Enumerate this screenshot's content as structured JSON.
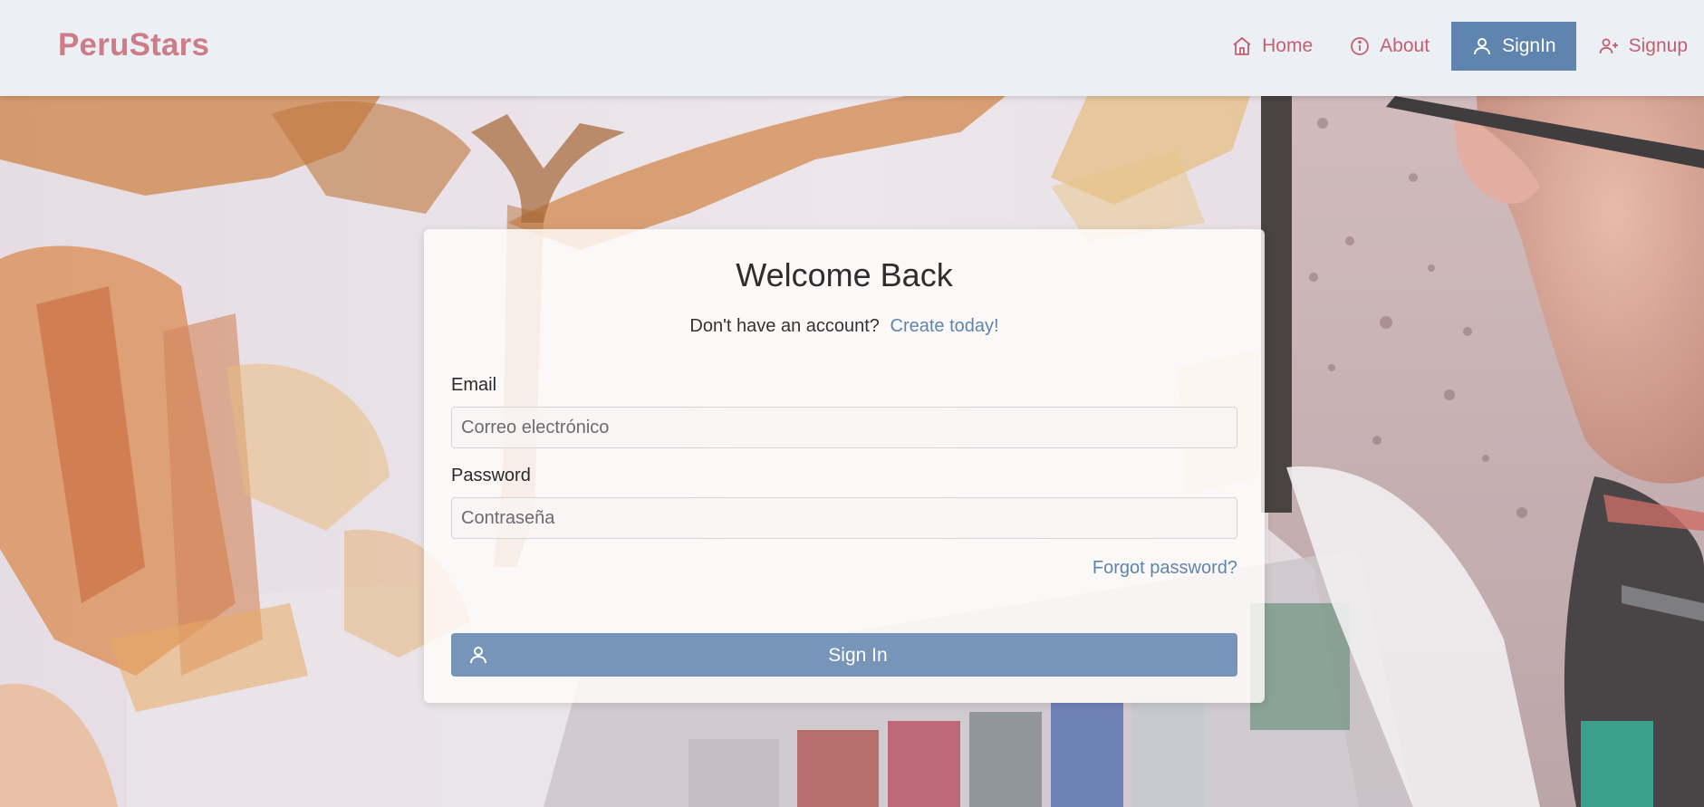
{
  "brand": {
    "name": "PeruStars"
  },
  "nav": {
    "items": [
      {
        "label": "Home",
        "icon": "home-icon",
        "active": false
      },
      {
        "label": "About",
        "icon": "info-icon",
        "active": false
      },
      {
        "label": "SignIn",
        "icon": "user-icon",
        "active": true
      },
      {
        "label": "Signup",
        "icon": "user-plus-icon",
        "active": false
      }
    ]
  },
  "login": {
    "title": "Welcome Back",
    "prompt": "Don't have an account?",
    "create_link": "Create today!",
    "email_label": "Email",
    "email_placeholder": "Correo electrónico",
    "email_value": "",
    "password_label": "Password",
    "password_placeholder": "Contraseña",
    "password_value": "",
    "forgot_link": "Forgot password?",
    "submit_label": "Sign In",
    "submit_icon": "user-icon"
  },
  "colors": {
    "brand": "#cc7d87",
    "nav_text": "#c2616f",
    "accent": "#5f84ae",
    "navbar_bg": "#eceff4"
  }
}
